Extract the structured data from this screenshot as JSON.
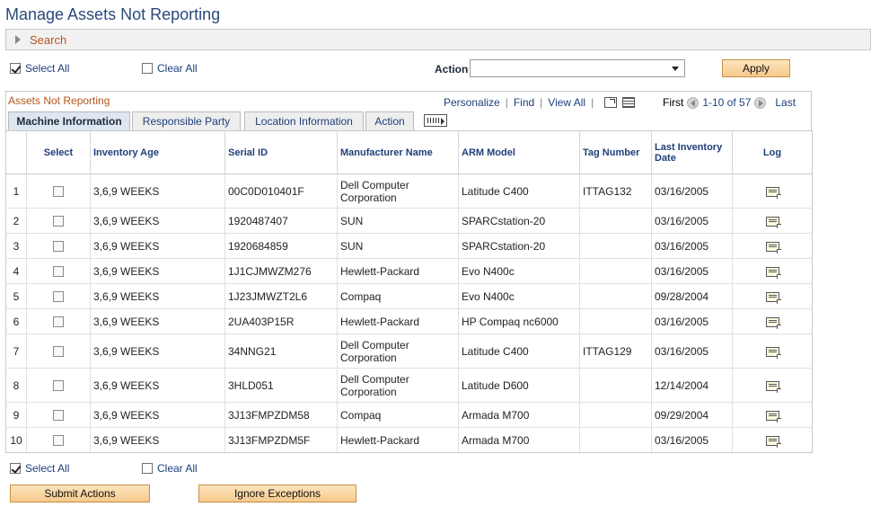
{
  "page": {
    "title": "Manage Assets Not Reporting"
  },
  "search": {
    "label": "Search"
  },
  "top_controls": {
    "select_all": "Select All",
    "clear_all": "Clear All",
    "action_label": "Action",
    "action_value": "",
    "apply": "Apply"
  },
  "grid": {
    "title": "Assets Not Reporting",
    "personalize": "Personalize",
    "find": "Find",
    "view_all": "View All",
    "first": "First",
    "range": "1-10 of 57",
    "last": "Last",
    "tabs": [
      "Machine Information",
      "Responsible Party",
      "Location Information",
      "Action"
    ],
    "columns": [
      "",
      "Select",
      "Inventory Age",
      "Serial ID",
      "Manufacturer Name",
      "ARM Model",
      "Tag Number",
      "Last Inventory Date",
      "Log"
    ],
    "rows": [
      {
        "num": "1",
        "age": "3,6,9 WEEKS",
        "serial": "00C0D010401F",
        "manufacturer": "Dell Computer Corporation",
        "model": "Latitude C400",
        "tag": "ITTAG132",
        "date": "03/16/2005"
      },
      {
        "num": "2",
        "age": "3,6,9 WEEKS",
        "serial": "1920487407",
        "manufacturer": "SUN",
        "model": "SPARCstation-20",
        "tag": "",
        "date": "03/16/2005"
      },
      {
        "num": "3",
        "age": "3,6,9 WEEKS",
        "serial": "1920684859",
        "manufacturer": "SUN",
        "model": "SPARCstation-20",
        "tag": "",
        "date": "03/16/2005"
      },
      {
        "num": "4",
        "age": "3,6,9 WEEKS",
        "serial": "1J1CJMWZM276",
        "manufacturer": "Hewlett-Packard",
        "model": "Evo N400c",
        "tag": "",
        "date": "03/16/2005"
      },
      {
        "num": "5",
        "age": "3,6,9 WEEKS",
        "serial": "1J23JMWZT2L6",
        "manufacturer": "Compaq",
        "model": "Evo N400c",
        "tag": "",
        "date": "09/28/2004"
      },
      {
        "num": "6",
        "age": "3,6,9 WEEKS",
        "serial": "2UA403P15R",
        "manufacturer": "Hewlett-Packard",
        "model": "HP Compaq nc6000",
        "tag": "",
        "date": "03/16/2005"
      },
      {
        "num": "7",
        "age": "3,6,9 WEEKS",
        "serial": "34NNG21",
        "manufacturer": "Dell Computer Corporation",
        "model": "Latitude C400",
        "tag": "ITTAG129",
        "date": "03/16/2005"
      },
      {
        "num": "8",
        "age": "3,6,9 WEEKS",
        "serial": "3HLD051",
        "manufacturer": "Dell Computer Corporation",
        "model": "Latitude D600",
        "tag": "",
        "date": "12/14/2004"
      },
      {
        "num": "9",
        "age": "3,6,9 WEEKS",
        "serial": "3J13FMPZDM58",
        "manufacturer": "Compaq",
        "model": "Armada M700",
        "tag": "",
        "date": "09/29/2004"
      },
      {
        "num": "10",
        "age": "3,6,9 WEEKS",
        "serial": "3J13FMPZDM5F",
        "manufacturer": "Hewlett-Packard",
        "model": "Armada M700",
        "tag": "",
        "date": "03/16/2005"
      }
    ]
  },
  "bottom_controls": {
    "select_all": "Select All",
    "clear_all": "Clear All",
    "submit": "Submit Actions",
    "ignore": "Ignore Exceptions"
  },
  "colors": {
    "title": "#2b4a7a",
    "section_label": "#b5561c",
    "link": "#1e3f7a",
    "button": "#f5c98b"
  }
}
